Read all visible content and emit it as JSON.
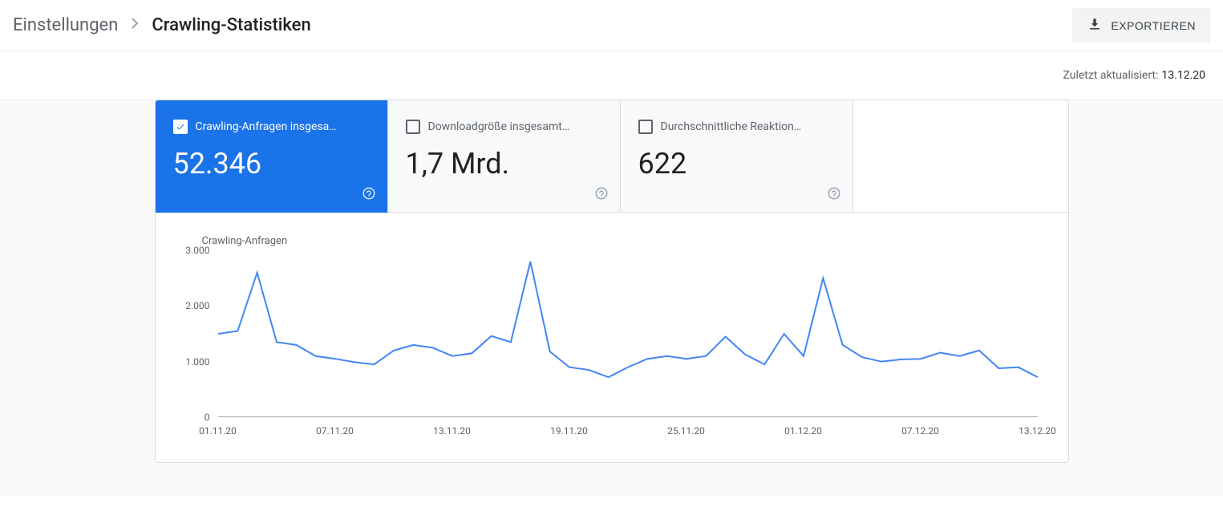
{
  "breadcrumb": {
    "parent": "Einstellungen",
    "current": "Crawling-Statistiken"
  },
  "export_label": "EXPORTIEREN",
  "last_updated_label": "Zuletzt aktualisiert:",
  "last_updated_date": "13.12.20",
  "tabs": [
    {
      "label": "Crawling-Anfragen insgesa…",
      "value": "52.346",
      "active": true
    },
    {
      "label": "Downloadgröße insgesamt…",
      "value": "1,7 Mrd.",
      "active": false
    },
    {
      "label": "Durchschnittliche Reaktion…",
      "value": "622",
      "active": false
    }
  ],
  "chart_data": {
    "type": "line",
    "title": "Crawling-Anfragen",
    "ylabel": "",
    "xlabel": "",
    "ylim": [
      0,
      3000
    ],
    "y_ticks": [
      0,
      1000,
      2000,
      3000
    ],
    "y_tick_labels": [
      "0",
      "1.000",
      "2.000",
      "3.000"
    ],
    "x_tick_labels": [
      "01.11.20",
      "07.11.20",
      "13.11.20",
      "19.11.20",
      "25.11.20",
      "01.12.20",
      "07.12.20",
      "13.12.20"
    ],
    "x_tick_positions": [
      0,
      6,
      12,
      18,
      24,
      30,
      36,
      42
    ],
    "series": [
      {
        "name": "Crawling-Anfragen",
        "color": "#4285f4",
        "x": [
          0,
          1,
          2,
          3,
          4,
          5,
          6,
          7,
          8,
          9,
          10,
          11,
          12,
          13,
          14,
          15,
          16,
          17,
          18,
          19,
          20,
          21,
          22,
          23,
          24,
          25,
          26,
          27,
          28,
          29,
          30,
          31,
          32,
          33,
          34,
          35,
          36,
          37,
          38,
          39,
          40,
          41,
          42
        ],
        "values": [
          1500,
          1550,
          2600,
          1350,
          1300,
          1100,
          1050,
          990,
          950,
          1200,
          1300,
          1250,
          1100,
          1150,
          1460,
          1350,
          2800,
          1180,
          900,
          850,
          720,
          900,
          1050,
          1100,
          1050,
          1100,
          1450,
          1130,
          950,
          1500,
          1100,
          2500,
          1300,
          1080,
          1000,
          1040,
          1050,
          1160,
          1100,
          1200,
          880,
          900,
          720
        ]
      }
    ]
  }
}
